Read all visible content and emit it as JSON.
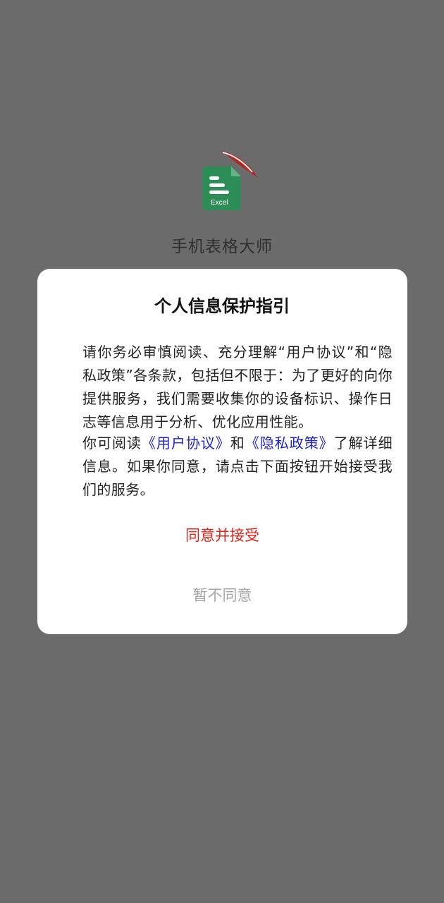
{
  "splash": {
    "app_name": "手机表格大师",
    "icon": {
      "name": "excel-file-icon",
      "label": "Excel",
      "color": "#2d8d57",
      "ribbon_color": "#b3261e"
    }
  },
  "dialog": {
    "title": "个人信息保护指引",
    "paragraph1": "请你务必审慎阅读、充分理解“用户协议”和“隐私政策”各条款，包括但不限于：为了更好的向你提供服务，我们需要收集你的设备标识、操作日志等信息用于分析、优化应用性能。",
    "paragraph2": {
      "prefix": "你可阅读",
      "user_agreement_link": "《用户协议》",
      "middle": "和",
      "privacy_policy_link": "《隐私政策》",
      "suffix": "了解详细信息。如果你同意，请点击下面按钮开始接受我们的服务。"
    },
    "agree_button": "同意并接受",
    "disagree_button": "暂不同意"
  },
  "colors": {
    "overlay": "#6b6b6b",
    "link": "#1d23c9",
    "agree": "#e2261c",
    "disagree": "#a7a7a7"
  }
}
